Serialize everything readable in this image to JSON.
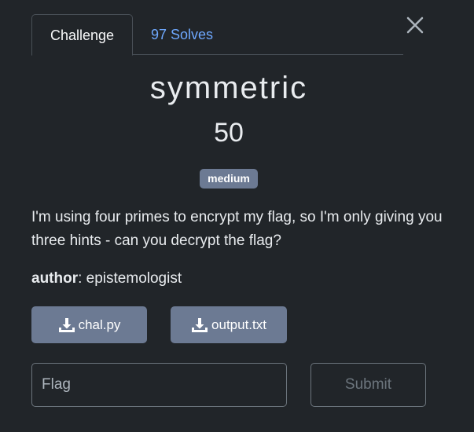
{
  "tabs": {
    "challenge": "Challenge",
    "solves": "97 Solves"
  },
  "challenge": {
    "name": "symmetric",
    "points": "50",
    "difficulty": "medium",
    "description": "I'm using four primes to encrypt my flag, so I'm only giving you three hints - can you decrypt the flag?",
    "author_label": "author",
    "author_separator": ": ",
    "author_name": "epistemologist"
  },
  "files": [
    {
      "label": "chal.py",
      "icon": "download-icon"
    },
    {
      "label": "output.txt",
      "icon": "download-icon"
    }
  ],
  "flag_input": {
    "placeholder": "Flag",
    "value": ""
  },
  "submit": {
    "label": "Submit"
  },
  "colors": {
    "background": "#212529",
    "tab_link": "#6ea8fe",
    "badge": "#6c7a93",
    "file_button": "#6c7a93",
    "border": "#6c757d"
  },
  "icons": {
    "close": "close-icon",
    "download": "download-icon"
  }
}
